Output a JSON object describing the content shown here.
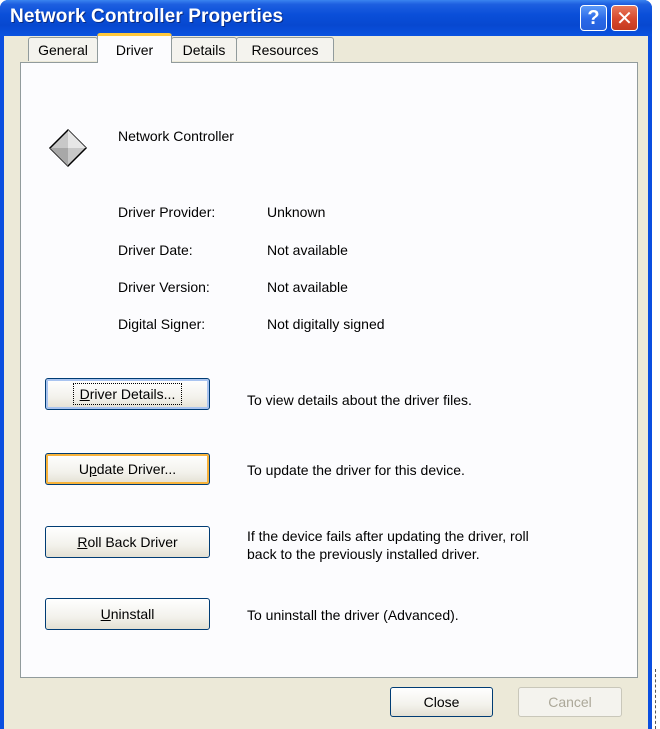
{
  "window": {
    "title": "Network Controller Properties",
    "help_glyph": "?",
    "close_glyph": "✕"
  },
  "tabs": [
    {
      "label": "General"
    },
    {
      "label": "Driver"
    },
    {
      "label": "Details"
    },
    {
      "label": "Resources"
    }
  ],
  "device": {
    "name": "Network Controller",
    "icon": "diamond-device-icon"
  },
  "info": [
    {
      "label": "Driver Provider:",
      "value": "Unknown"
    },
    {
      "label": "Driver Date:",
      "value": "Not available"
    },
    {
      "label": "Driver Version:",
      "value": "Not available"
    },
    {
      "label": "Digital Signer:",
      "value": "Not digitally signed"
    }
  ],
  "actions": [
    {
      "pre": "",
      "mnemonic": "D",
      "post": "river Details...",
      "description": "To view details about the driver files."
    },
    {
      "pre": "U",
      "mnemonic": "p",
      "post": "date Driver...",
      "description": "To update the driver for this device."
    },
    {
      "pre": "",
      "mnemonic": "R",
      "post": "oll Back Driver",
      "description_line1": "If the device fails after updating the driver, roll",
      "description_line2": "back to the previously installed driver."
    },
    {
      "pre": "",
      "mnemonic": "U",
      "post": "ninstall",
      "description": "To uninstall the driver (Advanced)."
    }
  ],
  "footer": {
    "close_label": "Close",
    "cancel_label": "Cancel"
  },
  "colors": {
    "titlebar": "#0a4fd9",
    "dialog_bg": "#ece9d8",
    "tab_highlight": "#ffc83c"
  }
}
